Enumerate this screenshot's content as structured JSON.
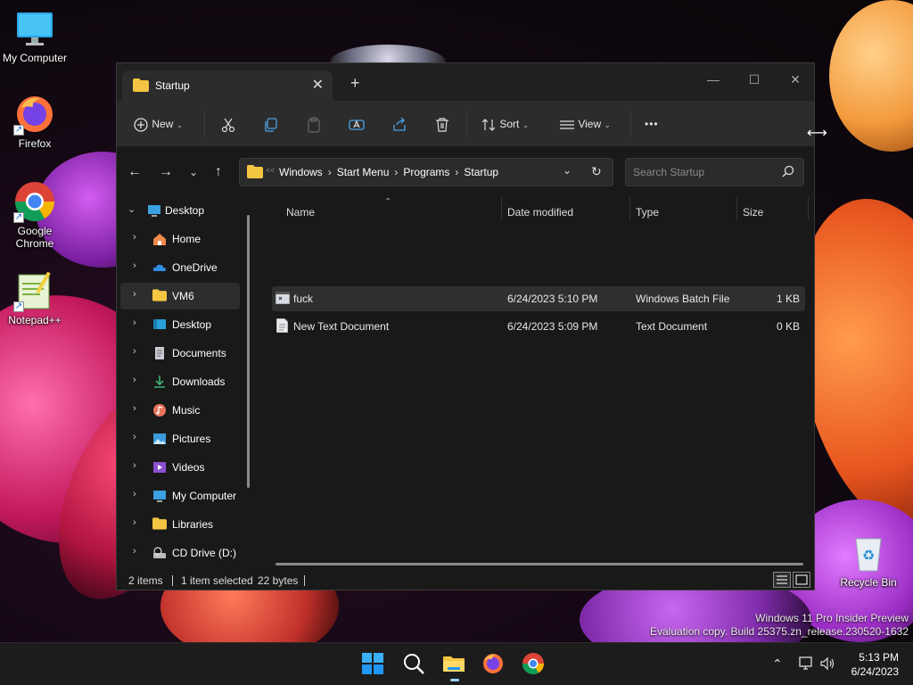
{
  "desktop": {
    "icons": [
      {
        "label": "My Computer"
      },
      {
        "label": "Firefox"
      },
      {
        "label": "Google Chrome"
      },
      {
        "label": "Notepad++"
      },
      {
        "label": "Recycle Bin"
      }
    ]
  },
  "window": {
    "tab_title": "Startup",
    "toolbar": {
      "new_label": "New",
      "sort_label": "Sort",
      "view_label": "View",
      "more_label": "•••"
    },
    "breadcrumb": [
      "Windows",
      "Start Menu",
      "Programs",
      "Startup"
    ],
    "breadcrumb_overflow": "<<",
    "search_placeholder": "Search Startup",
    "nav": [
      {
        "label": "Desktop",
        "icon": "desktop-icon",
        "expanded": true
      },
      {
        "label": "Home",
        "icon": "home-icon"
      },
      {
        "label": "OneDrive",
        "icon": "cloud-icon"
      },
      {
        "label": "VM6",
        "icon": "folder-icon",
        "selected": true
      },
      {
        "label": "Desktop",
        "icon": "desktop-icon"
      },
      {
        "label": "Documents",
        "icon": "document-icon"
      },
      {
        "label": "Downloads",
        "icon": "download-icon"
      },
      {
        "label": "Music",
        "icon": "music-icon"
      },
      {
        "label": "Pictures",
        "icon": "pictures-icon"
      },
      {
        "label": "Videos",
        "icon": "videos-icon"
      },
      {
        "label": "My Computer",
        "icon": "computer-icon"
      },
      {
        "label": "Libraries",
        "icon": "folder-icon"
      },
      {
        "label": "CD Drive (D:)",
        "icon": "cd-drive-icon"
      }
    ],
    "columns": [
      "Name",
      "Date modified",
      "Type",
      "Size"
    ],
    "files": [
      {
        "name": "fuck",
        "date": "6/24/2023 5:10 PM",
        "type": "Windows Batch File",
        "size": "1 KB",
        "selected": true
      },
      {
        "name": "New Text Document",
        "date": "6/24/2023 5:09 PM",
        "type": "Text Document",
        "size": "0 KB"
      }
    ],
    "status": {
      "count": "2 items",
      "selected": "1 item selected",
      "bytes": "22 bytes"
    }
  },
  "watermark": {
    "line1": "Windows 11 Pro Insider Preview",
    "line2": "Evaluation copy. Build 25375.zn_release.230520-1632"
  },
  "taskbar": {
    "time": "5:13 PM",
    "date": "6/24/2023"
  },
  "colors": {
    "accent": "#0078d4",
    "folder": "#f4c542",
    "window_bg": "#191919",
    "toolbar_bg": "#2c2c2c"
  }
}
